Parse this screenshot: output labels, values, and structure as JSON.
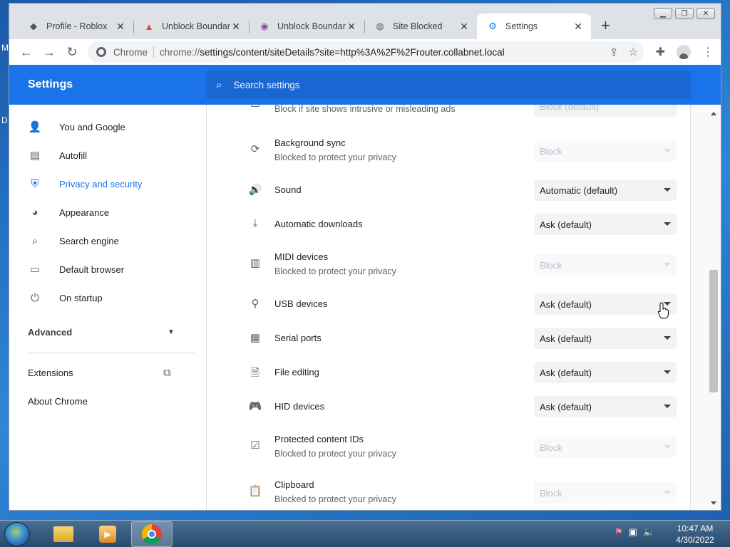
{
  "desktop": {
    "letters": [
      "M",
      "D"
    ]
  },
  "tabs": [
    {
      "title": "Profile - Roblox",
      "icon": "roblox-icon",
      "glyph": "◆"
    },
    {
      "title": "Unblock Boundary",
      "icon": "unblock-icon",
      "glyph": "▲"
    },
    {
      "title": "Unblock Boundary",
      "icon": "unblock-icon",
      "glyph": "◉"
    },
    {
      "title": "Site Blocked",
      "icon": "globe-icon",
      "glyph": "◍"
    },
    {
      "title": "Settings",
      "icon": "gear-icon",
      "glyph": "⚙"
    }
  ],
  "toolbar": {
    "site_chip": "Chrome",
    "url_prefix": "chrome://",
    "url_rest": "settings/content/siteDetails?site=http%3A%2F%2Frouter.collabnet.local"
  },
  "header": {
    "title": "Settings",
    "search_placeholder": "Search settings"
  },
  "sidebar": {
    "items": [
      {
        "label": "You and Google",
        "icon": "person-icon",
        "glyph": "👤"
      },
      {
        "label": "Autofill",
        "icon": "clipboard-icon",
        "glyph": "▤"
      },
      {
        "label": "Privacy and security",
        "icon": "shield-icon",
        "glyph": "⛨"
      },
      {
        "label": "Appearance",
        "icon": "palette-icon",
        "glyph": "◕"
      },
      {
        "label": "Search engine",
        "icon": "search-icon",
        "glyph": "⌕"
      },
      {
        "label": "Default browser",
        "icon": "browser-icon",
        "glyph": "▭"
      },
      {
        "label": "On startup",
        "icon": "power-icon",
        "glyph": "⏻"
      }
    ],
    "advanced": "Advanced",
    "extensions": "Extensions",
    "about": "About Chrome"
  },
  "permissions": [
    {
      "label": "",
      "sub": "Block if site shows intrusive or misleading ads",
      "value": "Block (default)",
      "disabled": false,
      "icon": "ads-icon",
      "glyph": "▭"
    },
    {
      "label": "Background sync",
      "sub": "Blocked to protect your privacy",
      "value": "Block",
      "disabled": true,
      "icon": "sync-icon",
      "glyph": "⟳"
    },
    {
      "label": "Sound",
      "sub": "",
      "value": "Automatic (default)",
      "disabled": false,
      "icon": "speaker-icon",
      "glyph": "🔊"
    },
    {
      "label": "Automatic downloads",
      "sub": "",
      "value": "Ask (default)",
      "disabled": false,
      "icon": "download-icon",
      "glyph": "⤓"
    },
    {
      "label": "MIDI devices",
      "sub": "Blocked to protect your privacy",
      "value": "Block",
      "disabled": true,
      "icon": "piano-icon",
      "glyph": "▥"
    },
    {
      "label": "USB devices",
      "sub": "",
      "value": "Ask (default)",
      "disabled": false,
      "icon": "usb-icon",
      "glyph": "⚲"
    },
    {
      "label": "Serial ports",
      "sub": "",
      "value": "Ask (default)",
      "disabled": false,
      "icon": "serial-port-icon",
      "glyph": "▦"
    },
    {
      "label": "File editing",
      "sub": "",
      "value": "Ask (default)",
      "disabled": false,
      "icon": "file-edit-icon",
      "glyph": "🗎"
    },
    {
      "label": "HID devices",
      "sub": "",
      "value": "Ask (default)",
      "disabled": false,
      "icon": "gamepad-icon",
      "glyph": "🎮"
    },
    {
      "label": "Protected content IDs",
      "sub": "Blocked to protect your privacy",
      "value": "Block",
      "disabled": true,
      "icon": "protected-content-icon",
      "glyph": "☑"
    },
    {
      "label": "Clipboard",
      "sub": "Blocked to protect your privacy",
      "value": "Block",
      "disabled": true,
      "icon": "clipboard-icon",
      "glyph": "📋"
    }
  ],
  "taskbar": {
    "time": "10:47 AM",
    "date": "4/30/2022"
  },
  "colors": {
    "accent": "#1a73e8",
    "header": "#1a73e8"
  }
}
